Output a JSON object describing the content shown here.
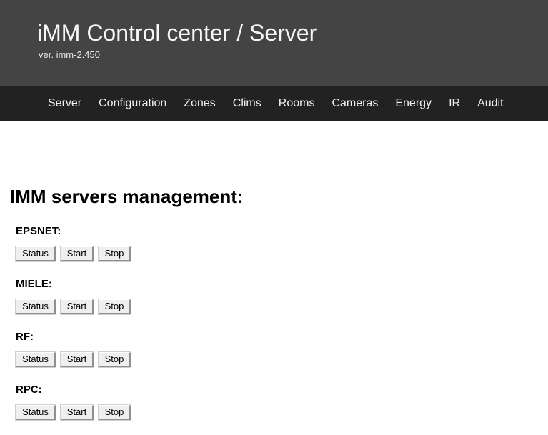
{
  "masthead": {
    "title": "iMM Control center / Server",
    "version": "ver. imm-2.450"
  },
  "nav": {
    "items": [
      {
        "label": "Server"
      },
      {
        "label": "Configuration"
      },
      {
        "label": "Zones"
      },
      {
        "label": "Clims"
      },
      {
        "label": "Rooms"
      },
      {
        "label": "Cameras"
      },
      {
        "label": "Energy"
      },
      {
        "label": "IR"
      },
      {
        "label": "Audit"
      }
    ]
  },
  "main": {
    "page_title": "IMM servers management:",
    "buttons": {
      "status": "Status",
      "start": "Start",
      "stop": "Stop"
    },
    "servers": [
      {
        "name": "EPSNET:",
        "key": "epsnet"
      },
      {
        "name": "MIELE:",
        "key": "miele"
      },
      {
        "name": "RF:",
        "key": "rf"
      },
      {
        "name": "RPC:",
        "key": "rpc"
      }
    ]
  },
  "colors": {
    "masthead_bg": "#444444",
    "navbar_bg": "#222222",
    "content_bg": "#ffffff",
    "nav_text": "#f2f2f2",
    "title_text": "#f7f7f7",
    "body_text": "#000000",
    "button_face": "#efefef"
  }
}
